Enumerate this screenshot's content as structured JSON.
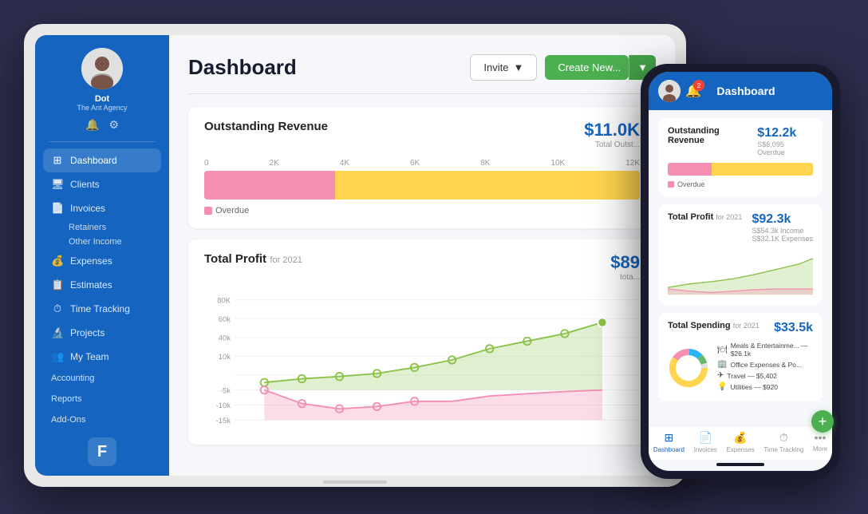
{
  "scene": {
    "background": "#2d2d4e"
  },
  "sidebar": {
    "user": {
      "name": "Dot",
      "company": "The Ant Agency"
    },
    "nav_items": [
      {
        "id": "dashboard",
        "label": "Dashboard",
        "icon": "⊞",
        "active": true
      },
      {
        "id": "clients",
        "label": "Clients",
        "icon": "🖥"
      },
      {
        "id": "invoices",
        "label": "Invoices",
        "icon": "📄"
      },
      {
        "id": "retainers",
        "label": "Retainers",
        "sub": true
      },
      {
        "id": "other-income",
        "label": "Other Income",
        "sub": true
      },
      {
        "id": "expenses",
        "label": "Expenses",
        "icon": "💰"
      },
      {
        "id": "estimates",
        "label": "Estimates",
        "icon": "📋"
      },
      {
        "id": "time-tracking",
        "label": "Time Tracking",
        "icon": "⏱"
      },
      {
        "id": "projects",
        "label": "Projects",
        "icon": "🔬"
      },
      {
        "id": "my-team",
        "label": "My Team",
        "icon": "👥"
      }
    ],
    "bottom_items": [
      {
        "id": "accounting",
        "label": "Accounting"
      },
      {
        "id": "reports",
        "label": "Reports"
      },
      {
        "id": "add-ons",
        "label": "Add-Ons"
      }
    ],
    "logo": "F"
  },
  "header": {
    "title": "Dashboard",
    "invite_label": "Invite",
    "create_label": "Create New..."
  },
  "revenue_card": {
    "title": "Outstanding Revenue",
    "value": "$11.0K",
    "value_label": "Total Outst...",
    "axis_labels": [
      "0",
      "2K",
      "4K",
      "6K",
      "8K",
      "10K",
      "12K"
    ],
    "legend": [
      {
        "label": "Overdue",
        "color": "#f48fb1"
      }
    ]
  },
  "profit_card": {
    "title": "Total Profit",
    "subtitle": "for 2021",
    "value": "$89",
    "value_label": "tota...",
    "y_labels": [
      "80K",
      "60k",
      "40k",
      "10k",
      "",
      "-5k",
      "-10k",
      "-15k"
    ]
  },
  "phone": {
    "notification_count": "2",
    "title": "Dashboard",
    "outstanding_revenue": {
      "title": "Outstanding Revenue",
      "value": "$12.2k",
      "sublabel": "S$6,095 Overdue",
      "legend": "Overdue"
    },
    "total_profit": {
      "title": "Total Profit",
      "subtitle": "for 2021",
      "value": "$92.3k",
      "income": "S$54.3k Income",
      "expenses": "S$32.1K Expenses"
    },
    "total_spending": {
      "title": "Total Spending",
      "subtitle": "for 2021",
      "value": "$33.5k",
      "items": [
        {
          "icon": "🍽",
          "label": "Meals & Entertainme...",
          "value": "— $26.1k"
        },
        {
          "icon": "🏢",
          "label": "Office Expenses & Po...",
          "value": ""
        },
        {
          "icon": "✈",
          "label": "Travel",
          "value": "— $5,402"
        },
        {
          "icon": "💡",
          "label": "Utilities",
          "value": "— $920"
        }
      ]
    },
    "bottom_nav": [
      {
        "id": "dashboard",
        "label": "Dashboard",
        "active": true
      },
      {
        "id": "invoices",
        "label": "Invoices",
        "active": false
      },
      {
        "id": "expenses",
        "label": "Expenses",
        "active": false
      },
      {
        "id": "time-tracking",
        "label": "Time Tracking",
        "active": false
      },
      {
        "id": "more",
        "label": "More",
        "active": false
      }
    ]
  }
}
